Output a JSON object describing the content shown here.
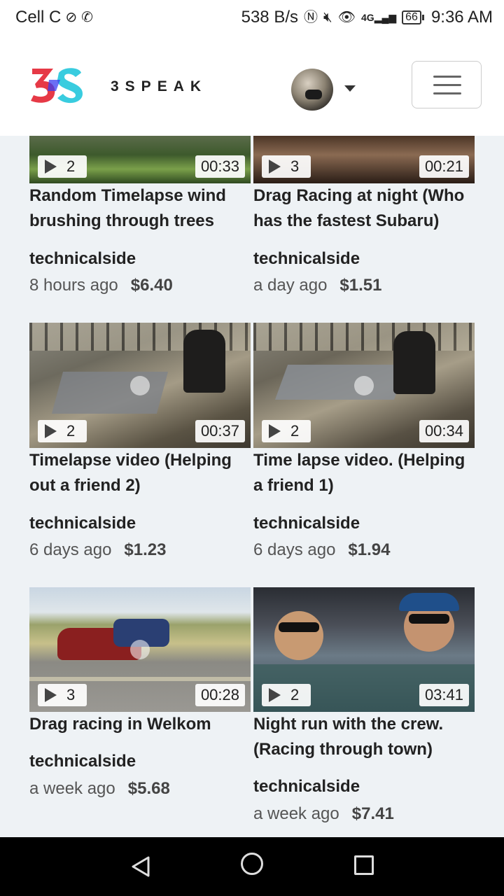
{
  "status_bar": {
    "carrier": "Cell C",
    "speed": "538 B/s",
    "network": "4G",
    "battery": "66",
    "time": "9:36 AM"
  },
  "header": {
    "logo_text": "3S",
    "brand": "3SPEAK"
  },
  "videos": [
    {
      "title": "Random Timelapse wind brushing through trees",
      "author": "technicalside",
      "age": "8 hours ago",
      "payout": "$6.40",
      "count": "2",
      "duration": "00:33"
    },
    {
      "title": "Drag Racing at night (Who has the fastest Subaru)",
      "author": "technicalside",
      "age": "a day ago",
      "payout": "$1.51",
      "count": "3",
      "duration": "00:21"
    },
    {
      "title": "Timelapse video (Helping out a friend 2)",
      "author": "technicalside",
      "age": "6 days ago",
      "payout": "$1.23",
      "count": "2",
      "duration": "00:37"
    },
    {
      "title": "Time lapse video. (Helping a friend 1)",
      "author": "technicalside",
      "age": "6 days ago",
      "payout": "$1.94",
      "count": "2",
      "duration": "00:34"
    },
    {
      "title": "Drag racing in Welkom",
      "author": "technicalside",
      "age": "a week ago",
      "payout": "$5.68",
      "count": "3",
      "duration": "00:28"
    },
    {
      "title": "Night run with the crew. (Racing through town)",
      "author": "technicalside",
      "age": "a week ago",
      "payout": "$7.41",
      "count": "2",
      "duration": "03:41"
    }
  ],
  "icons": {
    "whatsapp": "whatsapp-icon",
    "nfc": "nfc-icon",
    "mute": "mute-icon",
    "eye": "eye-icon",
    "signal": "signal-icon",
    "back": "back-icon",
    "home": "home-icon",
    "recents": "recents-icon"
  },
  "colors": {
    "logo_red": "#e63946",
    "logo_cyan": "#24c6dc",
    "logo_blue": "#3a3df0"
  }
}
